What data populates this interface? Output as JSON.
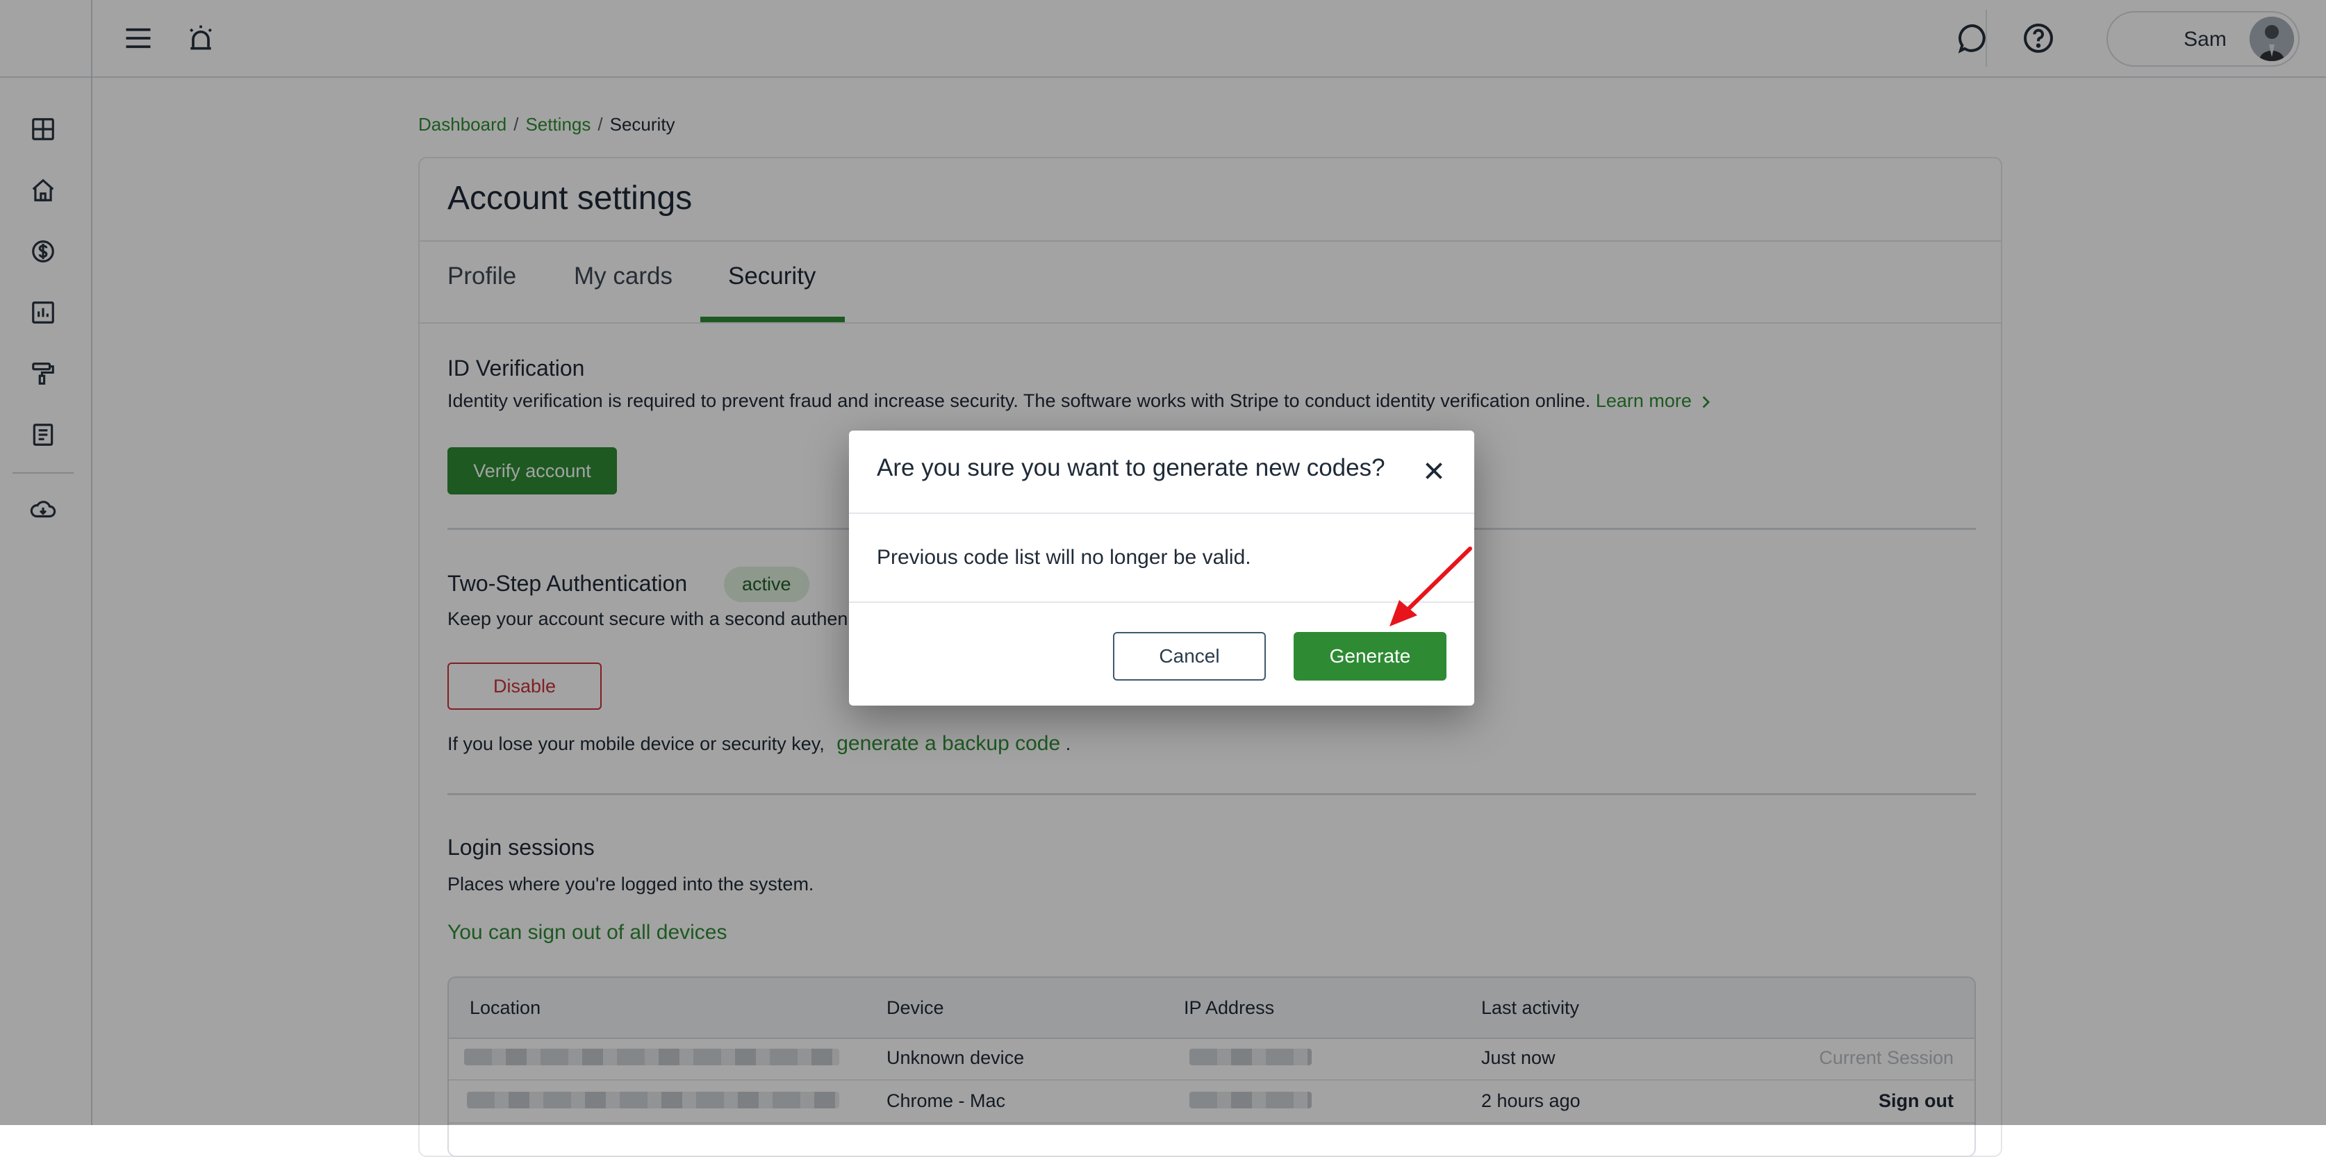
{
  "topbar": {
    "user_name": "Sam"
  },
  "breadcrumb": {
    "items": [
      "Dashboard",
      "Settings",
      "Security"
    ]
  },
  "page": {
    "title": "Account settings",
    "tabs": [
      {
        "label": "Profile"
      },
      {
        "label": "My cards"
      },
      {
        "label": "Security",
        "active": true
      }
    ]
  },
  "id_verification": {
    "title": "ID Verification",
    "description": "Identity verification is required to prevent fraud and increase security. The software works with Stripe to conduct identity verification online.",
    "learn_more": "Learn more",
    "verify_button": "Verify account"
  },
  "two_step": {
    "title": "Two-Step Authentication",
    "badge": "active",
    "description": "Keep your account secure with a second authen",
    "disable_button": "Disable",
    "backup_prefix": "If you lose your mobile device or security key,",
    "backup_link": "generate a backup code",
    "backup_suffix": "."
  },
  "login_sessions": {
    "title": "Login sessions",
    "description": "Places where you're logged into the system.",
    "sign_out_all": "You can sign out of all devices",
    "columns": [
      "Location",
      "Device",
      "IP Address",
      "Last activity"
    ],
    "rows": [
      {
        "device": "Unknown device",
        "last_activity": "Just now",
        "action": "Current Session"
      },
      {
        "device": "Chrome - Mac",
        "last_activity": "2 hours ago",
        "action": "Sign out"
      }
    ]
  },
  "modal": {
    "title": "Are you sure you want to generate new codes?",
    "body": "Previous code list will no longer be valid.",
    "cancel": "Cancel",
    "confirm": "Generate"
  },
  "colors": {
    "brand_green": "#2e8b34",
    "danger_red": "#c9313a",
    "annotation_arrow": "#e8141b"
  }
}
